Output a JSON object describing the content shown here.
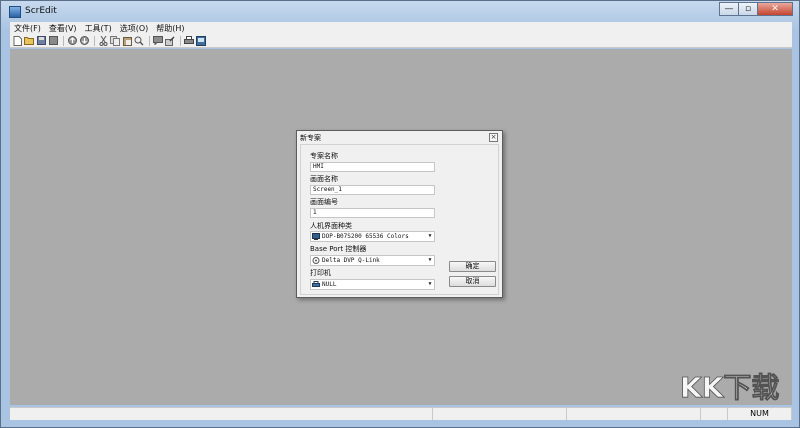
{
  "window": {
    "title": "ScrEdit"
  },
  "window_controls": {
    "minimize": "—",
    "maximize": "▫",
    "close": "✕"
  },
  "menubar": {
    "items": [
      "文件(F)",
      "查看(V)",
      "工具(T)",
      "选项(O)",
      "帮助(H)"
    ]
  },
  "toolbar": {
    "icons": [
      "new-file-icon",
      "open-folder-icon",
      "save-icon",
      "save-all-icon",
      "upload-icon",
      "download-icon",
      "cut-icon",
      "copy-icon",
      "paste-icon",
      "find-icon",
      "comment-icon",
      "edit-icon",
      "print-icon",
      "monitor-icon"
    ]
  },
  "statusbar": {
    "num": "NUM"
  },
  "watermark": {
    "text": "KK下载"
  },
  "dialog": {
    "title": "新专案",
    "close": "×",
    "project_name_label": "专案名称",
    "project_name_value": "HMI",
    "screen_name_label": "画面名称",
    "screen_name_value": "Screen_1",
    "screen_number_label": "画面编号",
    "screen_number_value": "1",
    "hmi_type_label": "人机界面种类",
    "hmi_type_value": "DOP-B07S200 65536 Colors",
    "base_port_label": "Base Port 控制器",
    "base_port_value": "Delta DVP Q-Link",
    "printer_label": "打印机",
    "printer_value": "NULL",
    "ok_button": "确定",
    "cancel_button": "取消"
  },
  "colors": {
    "client_background": "#ababab",
    "dialog_background": "#f0f0f0",
    "titlebar": "#a9c3e2"
  }
}
